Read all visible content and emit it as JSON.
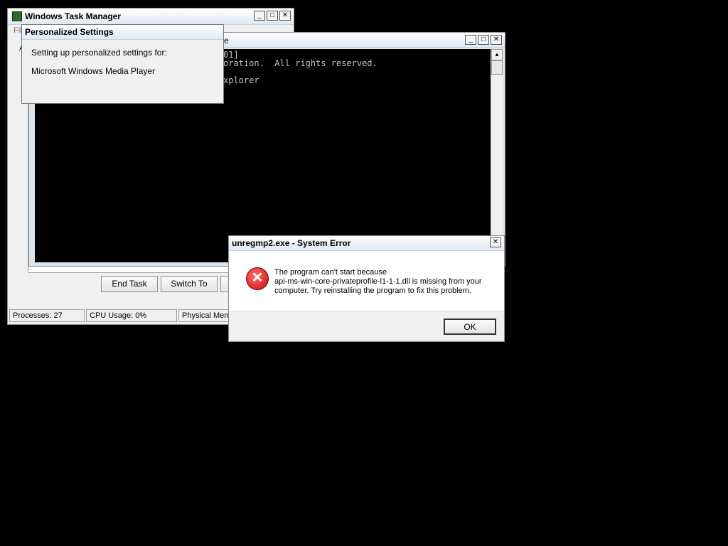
{
  "taskmgr": {
    "title": "Windows Task Manager",
    "menu_first": "Fil",
    "tab_first": "A",
    "buttons": [
      "End Task",
      "Switch To"
    ],
    "status": [
      "Processes: 27",
      "CPU Usage: 0%",
      "Physical Memo"
    ]
  },
  "personalized": {
    "title": "Personalized Settings",
    "line1": "Setting up personalized settings for:",
    "line2": "Microsoft Windows Media Player"
  },
  "cmd": {
    "title_tail": "e",
    "lines": [
      "01]",
      "oration.  All rights reserved.",
      "",
      "xplorer"
    ]
  },
  "error": {
    "title": "unregmp2.exe - System Error",
    "message1": "The program can't start because",
    "message2": "api-ms-win-core-privateprofile-l1-1-1.dll is missing from your",
    "message3": "computer. Try reinstalling the program to fix this problem.",
    "ok_label": "OK"
  },
  "caption_glyphs": {
    "minimize": "_",
    "maximize": "□",
    "close": "✕"
  },
  "colors": {
    "desktop": "#000000",
    "console_bg": "#000000",
    "error_icon": "#d42020"
  }
}
